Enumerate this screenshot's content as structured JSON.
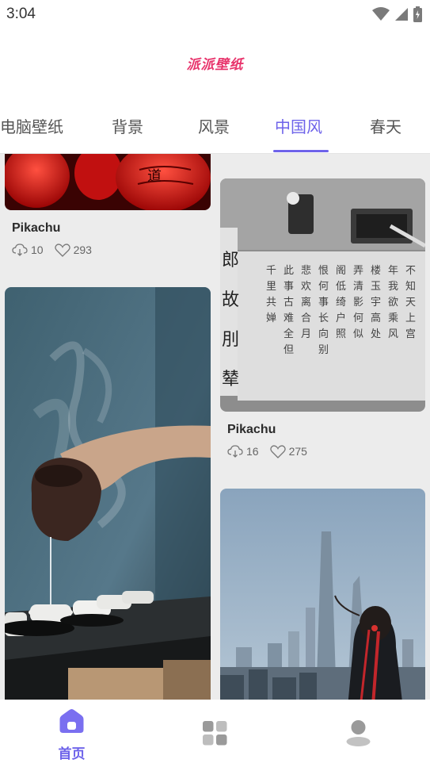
{
  "status_bar": {
    "time": "3:04",
    "icons": [
      "wifi-icon",
      "cellular-signal-icon",
      "battery-icon"
    ]
  },
  "header": {
    "logo_text": "派派壁纸"
  },
  "tabs": [
    {
      "label": "电脑壁纸",
      "active": false
    },
    {
      "label": "背景",
      "active": false
    },
    {
      "label": "风景",
      "active": false
    },
    {
      "label": "中国风",
      "active": true
    },
    {
      "label": "春天",
      "active": false
    }
  ],
  "cards": [
    {
      "title": "Pikachu",
      "downloads": "10",
      "likes": "293",
      "image": "red-lanterns"
    },
    {
      "title": "Pikachu",
      "downloads": "16",
      "likes": "275",
      "image": "chinese-calligraphy"
    },
    {
      "title": "",
      "downloads": "",
      "likes": "",
      "image": "tea-pouring"
    },
    {
      "title": "",
      "downloads": "",
      "likes": "",
      "image": "city-skyline-woman"
    }
  ],
  "bottom_nav": [
    {
      "label": "首页",
      "icon": "home-icon",
      "active": true
    },
    {
      "label": "",
      "icon": "grid-icon",
      "active": false
    },
    {
      "label": "",
      "icon": "user-icon",
      "active": false
    }
  ],
  "colors": {
    "accent": "#6e63ea",
    "brand": "#e8336b",
    "feed_background": "#ececec"
  }
}
